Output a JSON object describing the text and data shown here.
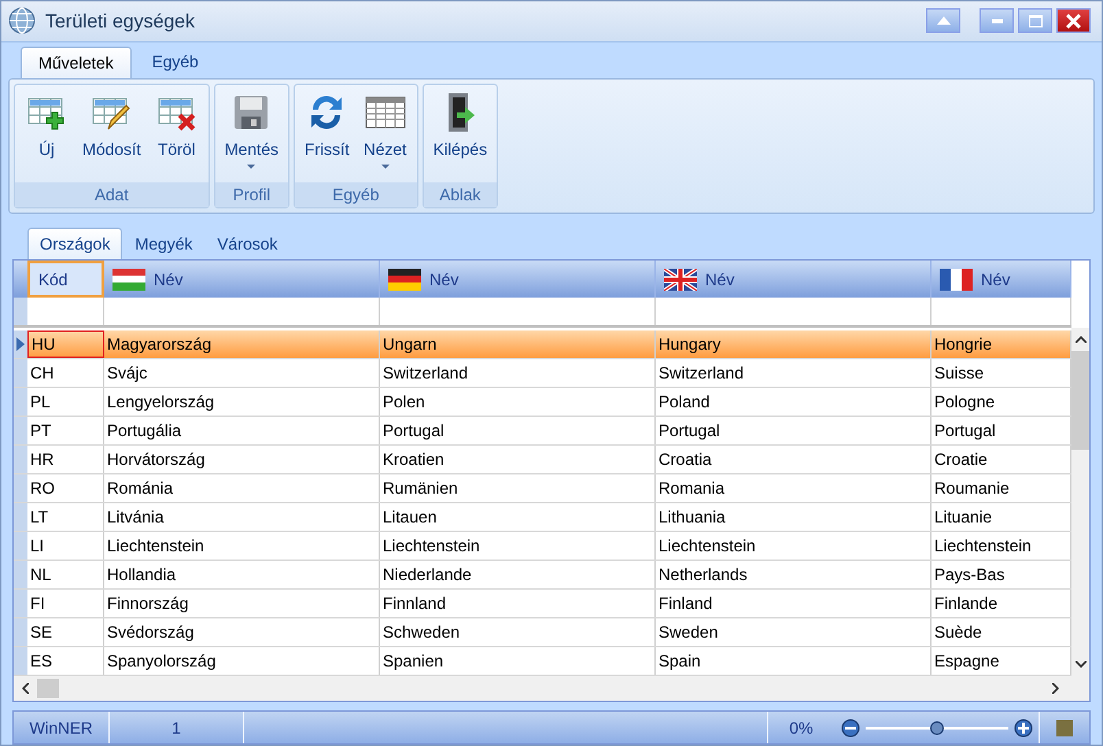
{
  "window": {
    "title": "Területi egységek"
  },
  "ribbon_tabs": [
    {
      "label": "Műveletek",
      "selected": true
    },
    {
      "label": "Egyéb",
      "selected": false
    }
  ],
  "ribbon_groups": [
    {
      "label": "Adat",
      "buttons": [
        {
          "label": "Új",
          "dropdown": false
        },
        {
          "label": "Módosít",
          "dropdown": false
        },
        {
          "label": "Töröl",
          "dropdown": false
        }
      ]
    },
    {
      "label": "Profil",
      "buttons": [
        {
          "label": "Mentés",
          "dropdown": true
        }
      ]
    },
    {
      "label": "Egyéb",
      "buttons": [
        {
          "label": "Frissít",
          "dropdown": false
        },
        {
          "label": "Nézet",
          "dropdown": true
        }
      ]
    },
    {
      "label": "Ablak",
      "buttons": [
        {
          "label": "Kilépés",
          "dropdown": false
        }
      ]
    }
  ],
  "view_tabs": [
    {
      "label": "Országok",
      "selected": true
    },
    {
      "label": "Megyék",
      "selected": false
    },
    {
      "label": "Városok",
      "selected": false
    }
  ],
  "table": {
    "columns": [
      "Kód",
      "Név",
      "Név",
      "Név",
      "Név"
    ],
    "rows": [
      {
        "selected": true,
        "cells": [
          "HU",
          "Magyarország",
          "Ungarn",
          "Hungary",
          "Hongrie"
        ]
      },
      {
        "selected": false,
        "cells": [
          "CH",
          "Svájc",
          "Switzerland",
          "Switzerland",
          "Suisse"
        ]
      },
      {
        "selected": false,
        "cells": [
          "PL",
          "Lengyelország",
          "Polen",
          "Poland",
          "Pologne"
        ]
      },
      {
        "selected": false,
        "cells": [
          "PT",
          "Portugália",
          "Portugal",
          "Portugal",
          "Portugal"
        ]
      },
      {
        "selected": false,
        "cells": [
          "HR",
          "Horvátország",
          "Kroatien",
          "Croatia",
          "Croatie"
        ]
      },
      {
        "selected": false,
        "cells": [
          "RO",
          "Románia",
          "Rumänien",
          "Romania",
          "Roumanie"
        ]
      },
      {
        "selected": false,
        "cells": [
          "LT",
          "Litvánia",
          "Litauen",
          "Lithuania",
          "Lituanie"
        ]
      },
      {
        "selected": false,
        "cells": [
          "LI",
          "Liechtenstein",
          "Liechtenstein",
          "Liechtenstein",
          "Liechtenstein"
        ]
      },
      {
        "selected": false,
        "cells": [
          "NL",
          "Hollandia",
          "Niederlande",
          "Netherlands",
          "Pays-Bas"
        ]
      },
      {
        "selected": false,
        "cells": [
          "FI",
          "Finnország",
          "Finnland",
          "Finland",
          "Finlande"
        ]
      },
      {
        "selected": false,
        "cells": [
          "SE",
          "Svédország",
          "Schweden",
          "Sweden",
          "Suède"
        ]
      },
      {
        "selected": false,
        "cells": [
          "ES",
          "Spanyolország",
          "Spanien",
          "Spain",
          "Espagne"
        ]
      }
    ]
  },
  "status_bar": {
    "app": "WinNER",
    "count": "1",
    "zoom_reading": "0%",
    "zoom": {
      "level": 0.5
    }
  }
}
